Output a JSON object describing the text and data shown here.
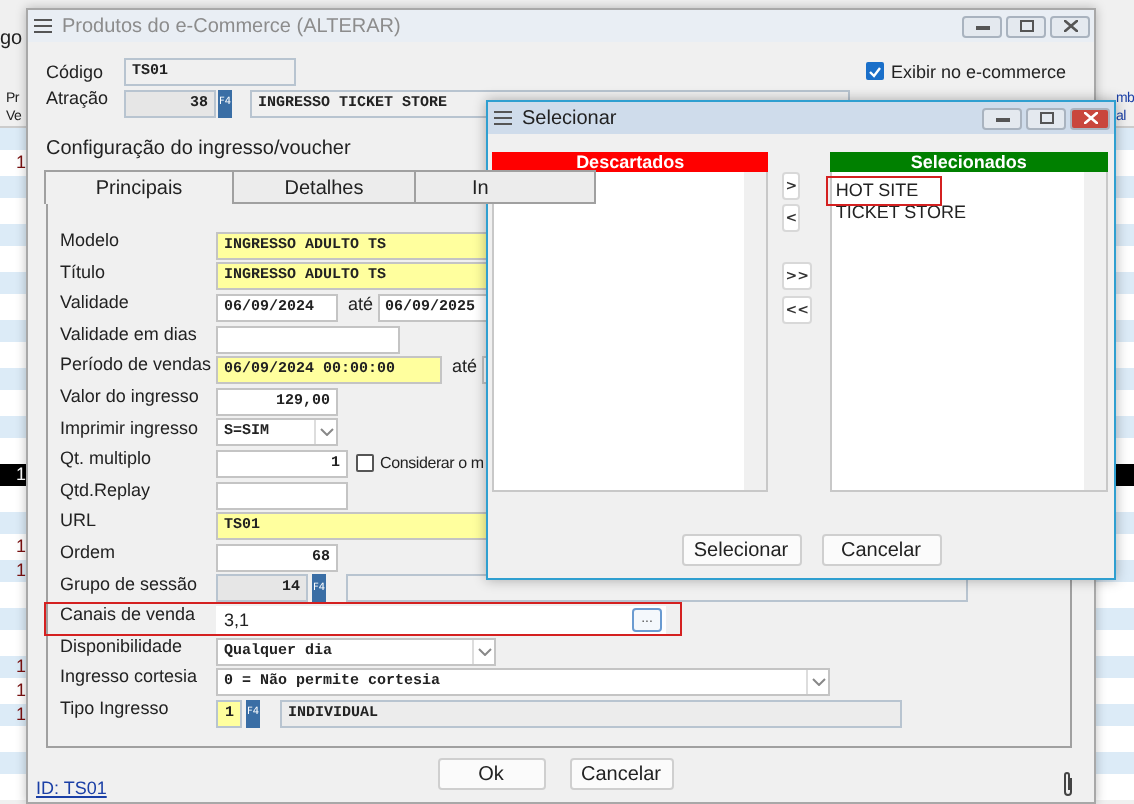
{
  "background_app": {
    "label": "go",
    "table": {
      "columns": [
        {
          "label": "Pr\nVe"
        },
        {
          "label": "mb\nal"
        }
      ],
      "rows": [
        {
          "column_1": "",
          "selected": false
        },
        {
          "column_1": "1",
          "selected": false
        },
        {
          "selected": false
        },
        {
          "selected": false
        },
        {
          "selected": false
        },
        {
          "selected": false
        },
        {
          "selected": false
        },
        {
          "selected": false
        },
        {
          "selected": false
        },
        {
          "selected": false
        },
        {
          "selected": false
        },
        {
          "selected": false
        },
        {
          "selected": false
        },
        {
          "selected": false
        },
        {
          "column_1": "1",
          "selected": true
        },
        {
          "selected": false
        },
        {
          "selected": false
        },
        {
          "column_1": "1",
          "selected": false
        },
        {
          "column_1": "1",
          "selected": false
        },
        {
          "selected": false
        },
        {
          "selected": false
        },
        {
          "selected": false
        },
        {
          "column_1": "1",
          "selected": false
        },
        {
          "column_1": "1",
          "selected": false
        },
        {
          "column_1": "1",
          "selected": false
        },
        {
          "selected": false
        },
        {
          "selected": false
        },
        {
          "selected": false
        }
      ]
    }
  },
  "window": {
    "title": "Produtos do e-Commerce (ALTERAR)",
    "active": false
  },
  "codigo": {
    "label": "Código",
    "value": "TS01"
  },
  "atracao": {
    "label": "Atração",
    "value": "38",
    "button": "F4",
    "description": "INGRESSO TICKET STORE"
  },
  "exibir": {
    "label": "Exibir no e-commerce",
    "checked": true
  },
  "section_title": "Configuração do ingresso/voucher",
  "tabs": [
    {
      "label": "Principais",
      "selected": true
    },
    {
      "label": "Detalhes",
      "selected": false
    },
    {
      "label": "In",
      "selected": false
    }
  ],
  "rows": [
    {
      "label": "Modelo",
      "kind": "field",
      "value": "INGRESSO ADULTO TS",
      "required": true
    },
    {
      "label": "Título",
      "kind": "field",
      "value": "INGRESSO ADULTO TS",
      "required": true
    },
    {
      "label": "Validade",
      "kind": "range",
      "value": "06/09/2024",
      "to_label": "até",
      "to": "06/09/2025",
      "required": false
    },
    {
      "label": "Validade em dias",
      "kind": "number",
      "required": false
    },
    {
      "label": "Período de vendas",
      "kind": "range",
      "value": "06/09/2024 00:00:00",
      "to_label": "até",
      "required": true
    },
    {
      "label": "Valor do ingresso",
      "kind": "number",
      "value": "129,00",
      "required": false
    },
    {
      "label": "Imprimir ingresso",
      "kind": "dropdown",
      "value": "S=SIM",
      "required": false
    },
    {
      "label": "Qt. multiplo",
      "kind": "number",
      "value": "1",
      "required": false,
      "checkbox": {
        "label": "Considerar o m",
        "checked": false
      }
    },
    {
      "label": "Qtd.Replay",
      "kind": "number",
      "required": false
    },
    {
      "label": "URL",
      "kind": "field",
      "value": "TS01",
      "required": true
    },
    {
      "label": "Ordem",
      "kind": "number",
      "value": "68",
      "required": false
    },
    {
      "label": "Grupo de sessão",
      "kind": "lookup",
      "value": "14",
      "button": "F4",
      "required": false
    },
    {
      "label": "Canais de venda",
      "kind": "picker",
      "value": "3,1",
      "button": "...",
      "required": false,
      "highlighted": true
    },
    {
      "label": "Disponibilidade",
      "kind": "dropdown",
      "value": "Qualquer dia",
      "required": false
    },
    {
      "label": "Ingresso cortesia",
      "kind": "dropdown",
      "value": "0 = Não permite cortesia",
      "required": false
    },
    {
      "label": "Tipo Ingresso",
      "kind": "lookup",
      "value": "1",
      "button": "F4",
      "description": "INDIVIDUAL",
      "required": true
    }
  ],
  "footer": {
    "id_link": "ID: TS01",
    "buttons": [
      {
        "label": "Ok"
      },
      {
        "label": "Cancelar"
      }
    ]
  },
  "dialog": {
    "title": "Selecionar",
    "active": true,
    "discarded": {
      "title": "Descartados",
      "color": "#ff0000"
    },
    "selected_list": {
      "title": "Selecionados",
      "color": "#008000",
      "items": [
        {
          "label": "HOT SITE",
          "highlighted": true
        },
        {
          "label": "TICKET STORE",
          "highlighted": false
        }
      ]
    },
    "move_buttons": [
      ">",
      "<",
      ">>",
      "<<"
    ],
    "buttons": [
      {
        "label": "Selecionar"
      },
      {
        "label": "Cancelar"
      }
    ]
  }
}
